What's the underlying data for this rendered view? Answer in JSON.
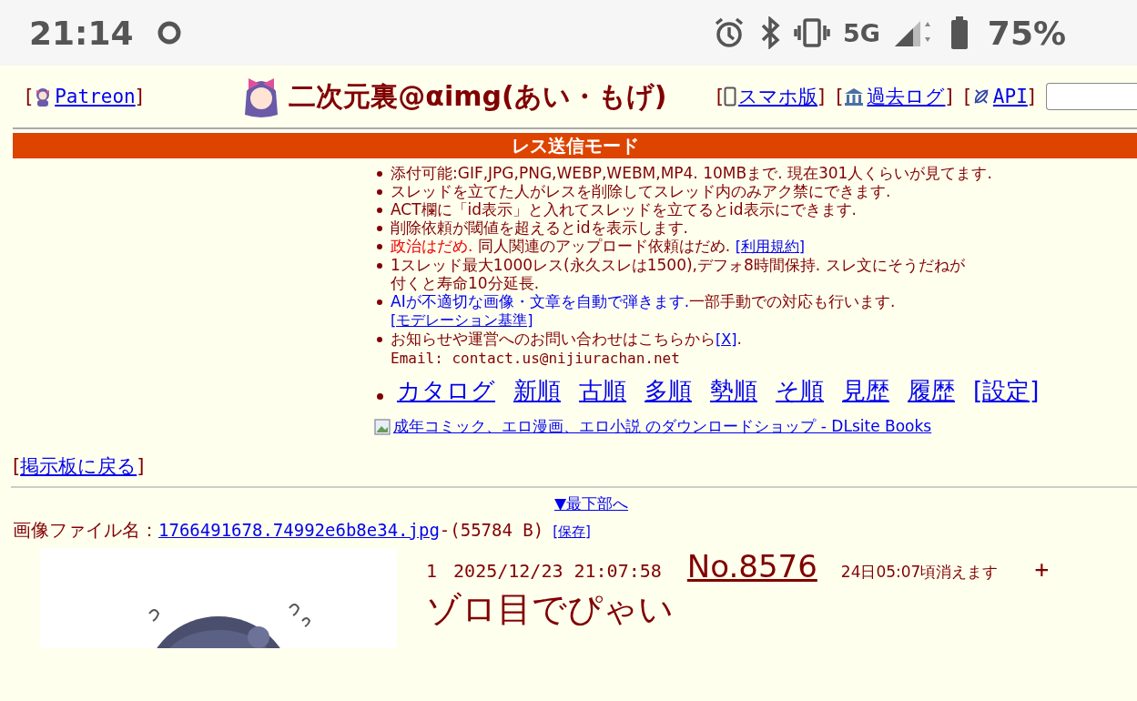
{
  "status_bar": {
    "time": "21:14",
    "network": "5G",
    "battery": "75%"
  },
  "header": {
    "left_links": [
      {
        "prefix": "[",
        "text": "Patreon",
        "suffix": "]"
      }
    ],
    "title": "二次元裏@αimg(あい・もげ)",
    "right_links": [
      {
        "prefix": "[",
        "text": "スマホ版",
        "suffix": "]"
      },
      {
        "prefix": "[",
        "text": "過去ログ",
        "suffix": "]"
      },
      {
        "prefix": "[",
        "text": "API",
        "suffix": "]"
      }
    ]
  },
  "mode_bar": "レス送信モード",
  "rules": [
    {
      "lines": [
        [
          {
            "kind": "plain",
            "text": "添付可能:GIF,JPG,PNG,WEBP,WEBM,MP4. 10MBまで. 現在301人くらいが見てます."
          }
        ]
      ]
    },
    {
      "lines": [
        [
          {
            "kind": "plain",
            "text": "スレッドを立てた人がレスを削除してスレッド内のみアク禁にできます."
          }
        ]
      ]
    },
    {
      "lines": [
        [
          {
            "kind": "plain",
            "text": "ACT欄に「id表示」と入れてスレッドを立てるとid表示にできます."
          }
        ]
      ]
    },
    {
      "lines": [
        [
          {
            "kind": "plain",
            "text": "削除依頼が閾値を超えるとidを表示します."
          }
        ]
      ]
    },
    {
      "lines": [
        [
          {
            "kind": "alert",
            "text": "政治はだめ."
          },
          {
            "kind": "plain",
            "text": " 同人関連のアップロード依頼はだめ. "
          },
          {
            "kind": "link",
            "text": "[利用規約]"
          }
        ]
      ]
    },
    {
      "lines": [
        [
          {
            "kind": "plain",
            "text": "1スレッド最大1000レス(永久スレは1500),デフォ8時間保持. スレ文にそうだねが"
          }
        ],
        [
          {
            "kind": "plain",
            "text": "付くと寿命10分延長."
          }
        ]
      ]
    },
    {
      "lines": [
        [
          {
            "kind": "notice",
            "text": "AIが不適切な画像・文章を自動で弾きます."
          },
          {
            "kind": "plain",
            "text": "一部手動での対応も行います."
          }
        ],
        [
          {
            "kind": "link",
            "text": "[モデレーション基準]"
          }
        ]
      ]
    },
    {
      "lines": [
        [
          {
            "kind": "plain",
            "text": "お知らせや運営へのお問い合わせはこちらから"
          },
          {
            "kind": "link",
            "text": "[X]"
          },
          {
            "kind": "plain",
            "text": "."
          }
        ],
        [
          {
            "kind": "mono",
            "text": "Email: contact.us@nijiurachan.net"
          }
        ]
      ]
    }
  ],
  "nav_links": [
    "カタログ",
    "新順",
    "古順",
    "多順",
    "勢順",
    "そ順",
    "見歴",
    "履歴",
    "[設定]"
  ],
  "ad_link": "成年コミック、エロ漫画、エロ小説 のダウンロードショップ - DLsite Books",
  "back_link": {
    "prefix": "[",
    "text": "掲示板に戻る",
    "suffix": "]"
  },
  "to_bottom": "▼最下部へ",
  "file": {
    "label": "画像ファイル名：",
    "name": "1766491678.74992e6b8e34.jpg",
    "size": "-(55784 B)",
    "save": "[保存]"
  },
  "post": {
    "number": "1",
    "date": "2025/12/23 21:07:58",
    "no": "No.8576",
    "expires": "24日05:07頃消えます",
    "plus": "+",
    "body": "ゾロ目でぴゃい"
  }
}
